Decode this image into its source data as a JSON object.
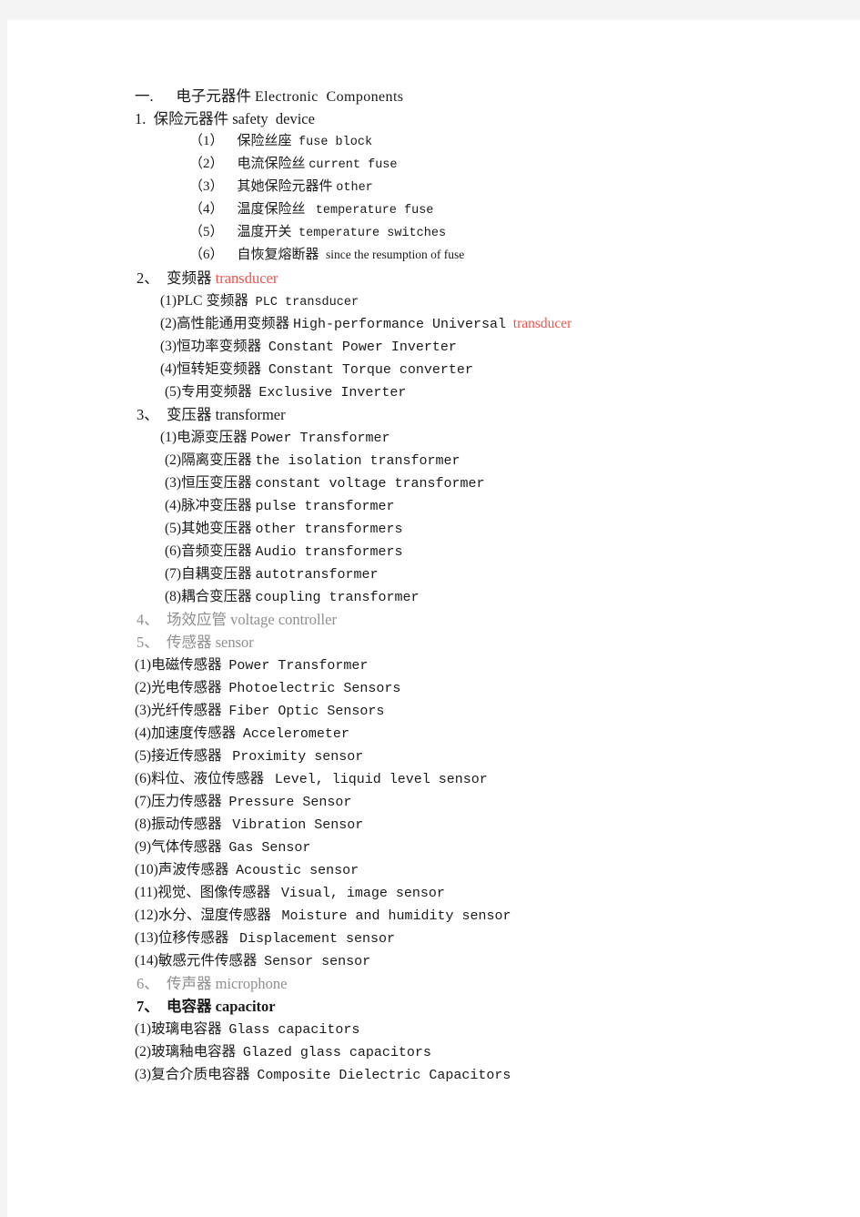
{
  "document": {
    "title_line": {
      "marker": "一.",
      "cn": "电子元器件",
      "en": "Electronic  Components"
    },
    "sections": [
      {
        "marker": "1.",
        "cn": "保险元器件",
        "en": "safety  device",
        "style": "normal",
        "indent": "flat",
        "items": [
          {
            "num": "（1）",
            "cn": "保险丝座",
            "en": "fuse block",
            "gap": "  "
          },
          {
            "num": "（2）",
            "cn": "电流保险丝",
            "en": "current fuse",
            "gap": " "
          },
          {
            "num": "（3）",
            "cn": "其她保险元器件",
            "en": "other",
            "gap": " "
          },
          {
            "num": "（4）",
            "cn": "温度保险丝",
            "en": "temperature fuse",
            "gap": "   "
          },
          {
            "num": "（5）",
            "cn": "温度开关",
            "en": "temperature switches",
            "gap": "  "
          },
          {
            "num": "（6）",
            "cn": "自恢复熔断器",
            "en": "since the resumption of fuse",
            "gap": "  ",
            "en_font": "serif"
          }
        ]
      },
      {
        "marker": "2、",
        "cn": "变频器",
        "en": "transducer",
        "style": "red-en",
        "indent": "a",
        "items": [
          {
            "num": "(1)",
            "cn": "PLC 变频器",
            "en": "PLC transducer",
            "gap": "  ",
            "en_font": "mono-small"
          },
          {
            "num": "(2)",
            "cn": "高性能通用变频器",
            "en": "High-performance Universal",
            "en2": "transducer",
            "gap": " "
          },
          {
            "num": "(3)",
            "cn": "恒功率变频器",
            "en": "Constant Power Inverter",
            "gap": "  "
          },
          {
            "num": "(4)",
            "cn": "恒转矩变频器",
            "en": "Constant Torque converter",
            "gap": "  "
          },
          {
            "num": "(5)",
            "cn": "专用变频器",
            "en": "Exclusive Inverter",
            "gap": "  ",
            "extra_indent": true
          }
        ]
      },
      {
        "marker": "3、",
        "cn": "变压器",
        "en": "transformer",
        "style": "normal",
        "indent": "a",
        "items": [
          {
            "num": "(1)",
            "cn": "电源变压器",
            "en": "Power Transformer",
            "gap": " "
          },
          {
            "num": "(2)",
            "cn": "隔离变压器",
            "en": "the isolation transformer",
            "gap": " ",
            "extra_indent": true
          },
          {
            "num": "(3)",
            "cn": "恒压变压器",
            "en": "constant voltage transformer",
            "gap": " ",
            "extra_indent": true
          },
          {
            "num": "(4)",
            "cn": "脉冲变压器",
            "en": "pulse transformer",
            "gap": " ",
            "extra_indent": true
          },
          {
            "num": "(5)",
            "cn": "其她变压器",
            "en": "other transformers",
            "gap": " ",
            "extra_indent": true
          },
          {
            "num": "(6)",
            "cn": "音频变压器",
            "en": "Audio transformers",
            "gap": " ",
            "extra_indent": true
          },
          {
            "num": "(7)",
            "cn": "自耦变压器",
            "en": "autotransformer",
            "gap": " ",
            "extra_indent": true
          },
          {
            "num": "(8)",
            "cn": "耦合变压器",
            "en": "coupling transformer",
            "gap": " ",
            "extra_indent": true
          }
        ]
      },
      {
        "marker": "4、",
        "cn": "场效应管",
        "en": "voltage controller",
        "style": "gray",
        "indent": "a",
        "items": []
      },
      {
        "marker": "5、",
        "cn": "传感器",
        "en": "sensor",
        "style": "gray",
        "indent": "a",
        "items": [
          {
            "num": "(1)",
            "cn": "电磁传感器",
            "en": "Power Transformer",
            "gap": "  ",
            "flat": true
          },
          {
            "num": "(2)",
            "cn": "光电传感器",
            "en": "Photoelectric Sensors",
            "gap": "  ",
            "flat": true
          },
          {
            "num": "(3)",
            "cn": "光纤传感器",
            "en": "Fiber Optic Sensors",
            "gap": "  ",
            "flat": true
          },
          {
            "num": "(4)",
            "cn": "加速度传感器",
            "en": "Accelerometer",
            "gap": "  ",
            "flat": true
          },
          {
            "num": "(5)",
            "cn": "接近传感器",
            "en": "Proximity sensor",
            "gap": "   ",
            "flat": true
          },
          {
            "num": "(6)",
            "cn": "料位、液位传感器",
            "en": "Level, liquid level sensor",
            "gap": "   ",
            "flat": true
          },
          {
            "num": "(7)",
            "cn": "压力传感器",
            "en": "Pressure Sensor",
            "gap": "  ",
            "flat": true
          },
          {
            "num": "(8)",
            "cn": "振动传感器",
            "en": "Vibration Sensor",
            "gap": "   ",
            "flat": true
          },
          {
            "num": "(9)",
            "cn": "气体传感器",
            "en": "Gas Sensor",
            "gap": "  ",
            "flat": true
          },
          {
            "num": "(10)",
            "cn": "声波传感器",
            "en": "Acoustic sensor",
            "gap": "  ",
            "flat": true
          },
          {
            "num": "(11)",
            "cn": "视觉、图像传感器",
            "en": "Visual, image sensor",
            "gap": "   ",
            "flat": true
          },
          {
            "num": "(12)",
            "cn": "水分、湿度传感器",
            "en": "Moisture and humidity sensor",
            "gap": "   ",
            "flat": true
          },
          {
            "num": "(13)",
            "cn": "位移传感器",
            "en": "Displacement sensor",
            "gap": "   ",
            "flat": true
          },
          {
            "num": "(14)",
            "cn": "敏感元件传感器",
            "en": "Sensor sensor",
            "gap": "  ",
            "flat": true
          }
        ]
      },
      {
        "marker": "6、",
        "cn": "传声器",
        "en": "microphone",
        "style": "gray",
        "indent": "a",
        "items": []
      },
      {
        "marker": "7、",
        "cn": "电容器",
        "en": "capacitor",
        "style": "bold",
        "indent": "a",
        "items": [
          {
            "num": "(1)",
            "cn": "玻璃电容器",
            "en": "Glass capacitors",
            "gap": "  ",
            "flat": true
          },
          {
            "num": "(2)",
            "cn": "玻璃釉电容器",
            "en": "Glazed glass capacitors",
            "gap": "  ",
            "flat": true
          },
          {
            "num": "(3)",
            "cn": "复合介质电容器",
            "en": "Composite Dielectric Capacitors",
            "gap": "  ",
            "flat": true
          }
        ]
      }
    ]
  },
  "colors": {
    "page_background": "#ffffff",
    "outer_background": "#f4f4f4",
    "text": "#1a1a1a",
    "gray_text": "#8f8f8f",
    "red_accent": "#f0534f"
  }
}
